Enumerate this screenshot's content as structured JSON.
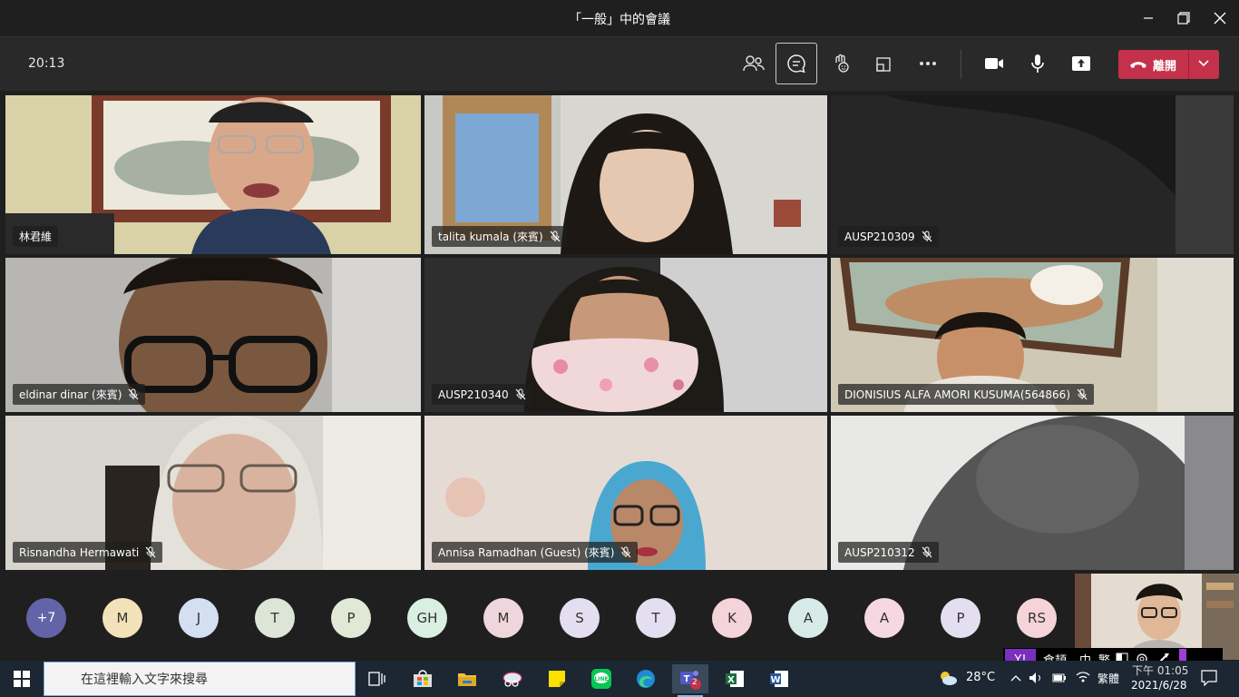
{
  "window": {
    "title": "「一般」中的會議"
  },
  "toolbar": {
    "timer": "20:13",
    "leave_label": "離開"
  },
  "participants": [
    {
      "name": "林君維"
    },
    {
      "name": "talita kumala (來賓)"
    },
    {
      "name": "AUSP210309"
    },
    {
      "name": "eldinar dinar (來賓)"
    },
    {
      "name": "AUSP210340"
    },
    {
      "name": "DIONISIUS ALFA AMORI KUSUMA(564866)"
    },
    {
      "name": "Risnandha Hermawati"
    },
    {
      "name": "Annisa Ramadhan (Guest) (來賓)"
    },
    {
      "name": "AUSP210312"
    }
  ],
  "overflow": {
    "more_count": "+7",
    "initials": [
      "M",
      "J",
      "T",
      "P",
      "GH",
      "M",
      "S",
      "T",
      "K",
      "A",
      "A",
      "P",
      "RS"
    ]
  },
  "colors": {
    "leave": "#c4314b",
    "more_bubble": "#6264a7",
    "avatar_bgs": [
      "#f3e2b9",
      "#d4e0f1",
      "#dde5d6",
      "#e1e8d5",
      "#d8efe2",
      "#efd6dc",
      "#e4dff0",
      "#e4dff0",
      "#f5d3da",
      "#d6ebe8",
      "#f5d8e2",
      "#e4dff0",
      "#f5d3d8"
    ]
  },
  "taskbar": {
    "search_placeholder": "在這裡輸入文字來搜尋",
    "teams_badge": "2",
    "weather": "28°C",
    "lang": "繁體",
    "time": "下午 01:05",
    "date": "2021/6/28"
  },
  "ime": {
    "label1": "倉頡",
    "label2": "中",
    "label3": "繁"
  }
}
